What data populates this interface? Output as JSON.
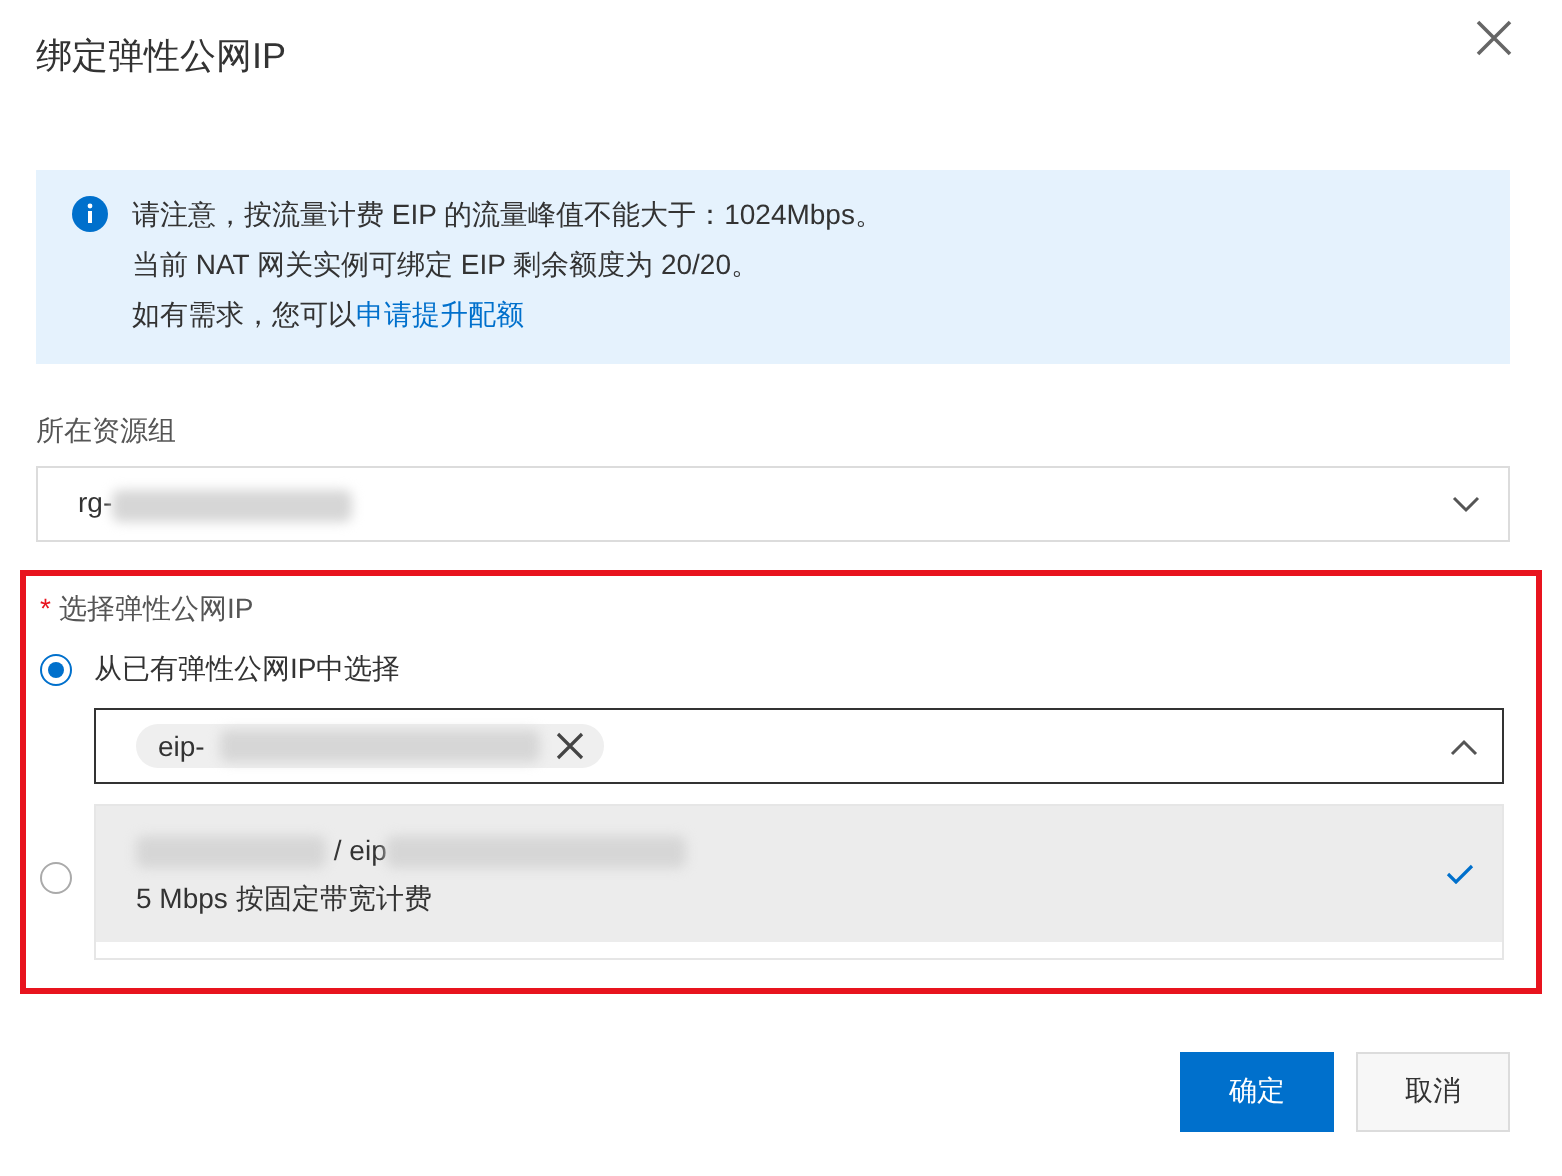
{
  "dialog": {
    "title": "绑定弹性公网IP"
  },
  "notice": {
    "lines": [
      "请注意，按流量计费 EIP 的流量峰值不能大于：1024Mbps。",
      "当前 NAT 网关实例可绑定 EIP 剩余额度为 20/20。"
    ],
    "last_line": "如有需求，您可以",
    "link": "申请提升配额"
  },
  "resource_group": {
    "label": "所在资源组",
    "value": "rg-"
  },
  "eip_section": {
    "required_mark": "*",
    "label": "选择弹性公网IP",
    "highlighted": true,
    "options": [
      {
        "label": "从已有弹性公网IP中选择",
        "selected": true
      },
      {
        "selected": false
      }
    ],
    "tags": [
      {
        "label": "eip-"
      }
    ],
    "expanded": true,
    "menu": [
      {
        "separator": "/ eip",
        "detail": "5 Mbps 按固定带宽计费",
        "selected": true
      }
    ]
  },
  "buttons": [
    {
      "label": "确定",
      "kind": "primary"
    },
    {
      "label": "取消",
      "kind": "default"
    }
  ]
}
